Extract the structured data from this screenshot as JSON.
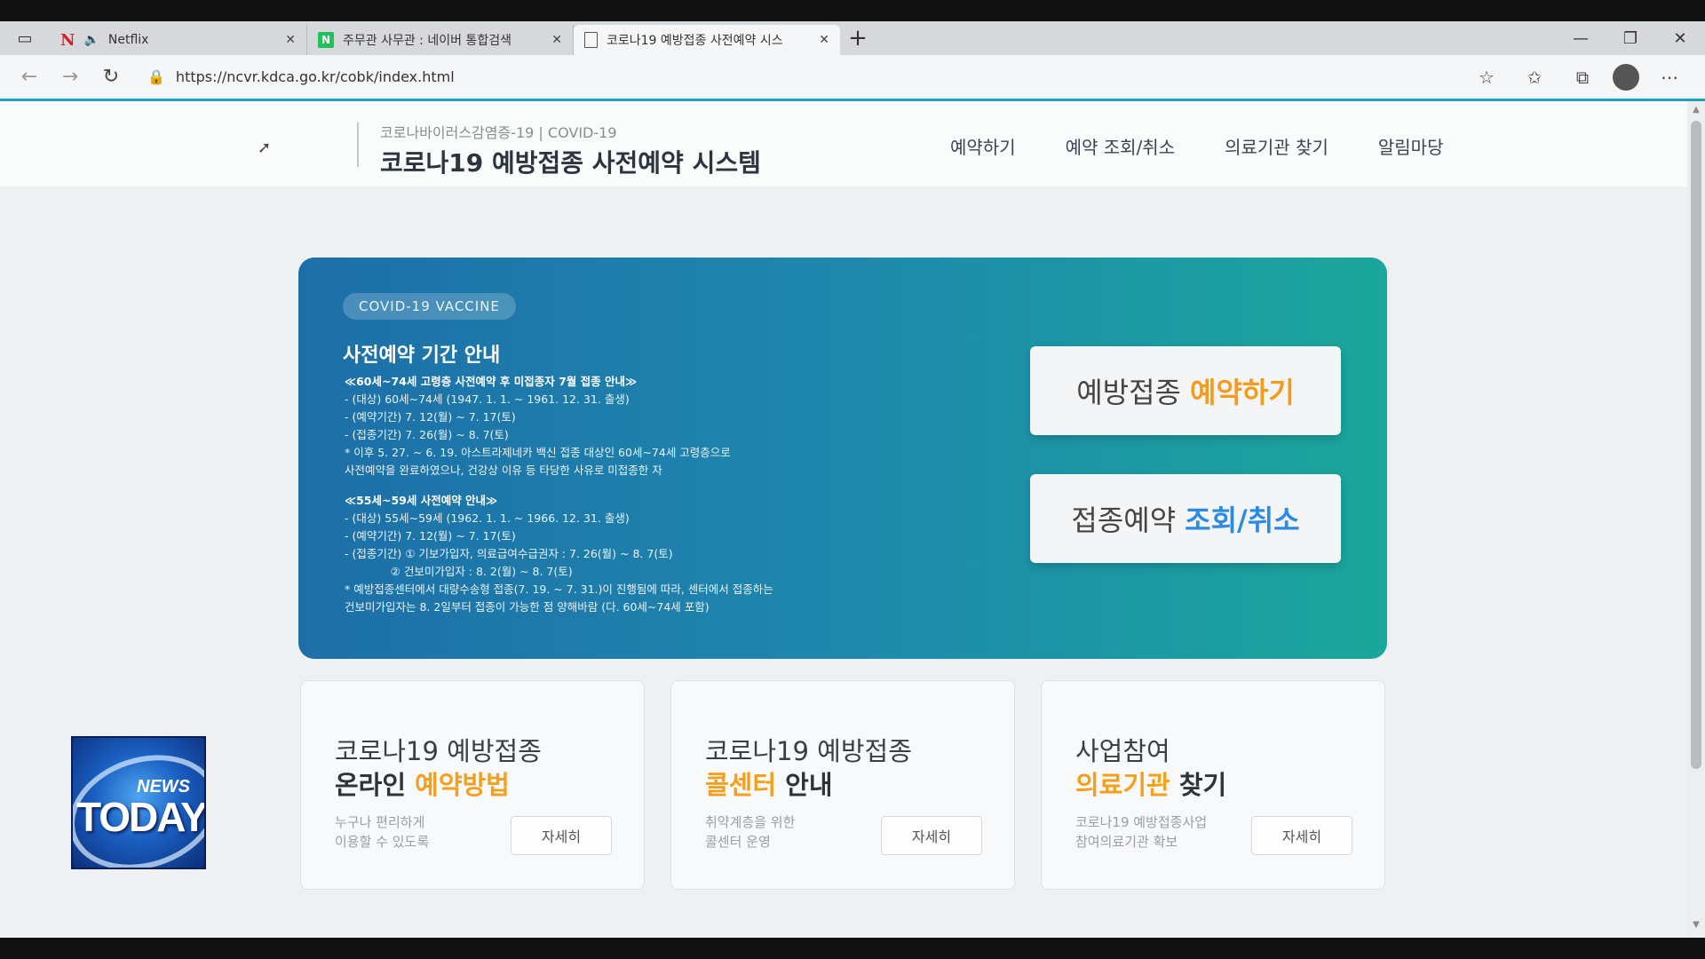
{
  "browser": {
    "tabs": [
      {
        "label": "Netflix",
        "icon": "netflix-icon",
        "audio": true
      },
      {
        "label": "주무관 사무관 : 네이버 통합검색",
        "icon": "naver-icon"
      },
      {
        "label": "코로나19 예방접종 사전예약 시스",
        "icon": "document-icon",
        "active": true
      }
    ],
    "url": "https://ncvr.kdca.go.kr/cobk/index.html",
    "accent": "#1aa3b8"
  },
  "header": {
    "subtitle": "코로나바이러스감염증-19 | COVID-19",
    "title": "코로나19 예방접종 사전예약 시스템",
    "nav": [
      "예약하기",
      "예약 조회/취소",
      "의료기관 찾기",
      "알림마당"
    ]
  },
  "hero": {
    "badge": "COVID-19 VACCINE",
    "title": "사전예약 기간 안내",
    "notice_section1": "≪60세~74세 고령층 사전예약 후 미접종자 7월 접종 안내≫",
    "notice_lines1": [
      "- (대상) 60세~74세 (1947. 1. 1. ~ 1961. 12. 31. 출생)",
      "- (예약기간) 7. 12(월) ~ 7. 17(토)",
      "- (접종기간) 7. 26(월) ~ 8. 7(토)",
      "* 이후 5. 27. ~ 6. 19. 아스트라제네카 백신 접종 대상인 60세~74세 고령층으로",
      "  사전예약을 완료하였으나, 건강상 이유 등 타당한 사유로 미접종한 자"
    ],
    "notice_section2": "≪55세~59세 사전예약 안내≫",
    "notice_lines2": [
      "- (대상) 55세~59세 (1962. 1. 1. ~ 1966. 12. 31. 출생)",
      "- (예약기간) 7. 12(월) ~ 7. 17(토)",
      "- (접종기간) ① 기보가입자, 의료급여수급권자 : 7. 26(월) ~ 8. 7(토)",
      "             ② 건보미가입자 : 8. 2(월) ~ 8. 7(토)",
      "* 예방접종센터에서 대량수송형 접종(7. 19. ~ 7. 31.)이 진행됨에 따라, 센터에서 접종하는",
      "  건보미가입자는 8. 2일부터 접종이 가능한 점 양해바람 (다. 60세~74세 포함)"
    ],
    "btn1_prefix": "예방접종",
    "btn1_highlight": "예약하기",
    "btn2_prefix": "접종예약",
    "btn2_highlight": "조회/취소"
  },
  "cards": [
    {
      "line1": "코로나19 예방접종",
      "line2_hl": "",
      "line2_pre": "온라인 ",
      "line2_highlight": "예약방법",
      "line2_post": "",
      "desc1": "누구나 편리하게",
      "desc2": "이용할 수 있도록",
      "button": "자세히"
    },
    {
      "line1": "코로나19 예방접종",
      "line2_pre": "",
      "line2_highlight": "콜센터",
      "line2_post": " 안내",
      "desc1": "취약계층을 위한",
      "desc2": "콜센터 운영",
      "button": "자세히"
    },
    {
      "line1": "사업참여",
      "line2_pre": "",
      "line2_highlight": "의료기관",
      "line2_post": " 찾기",
      "desc1": "코로나19 예방접종사업",
      "desc2": "참여의료기관 확보",
      "button": "자세히"
    }
  ],
  "overlay": {
    "news": "NEWS",
    "today": "TODAY"
  }
}
